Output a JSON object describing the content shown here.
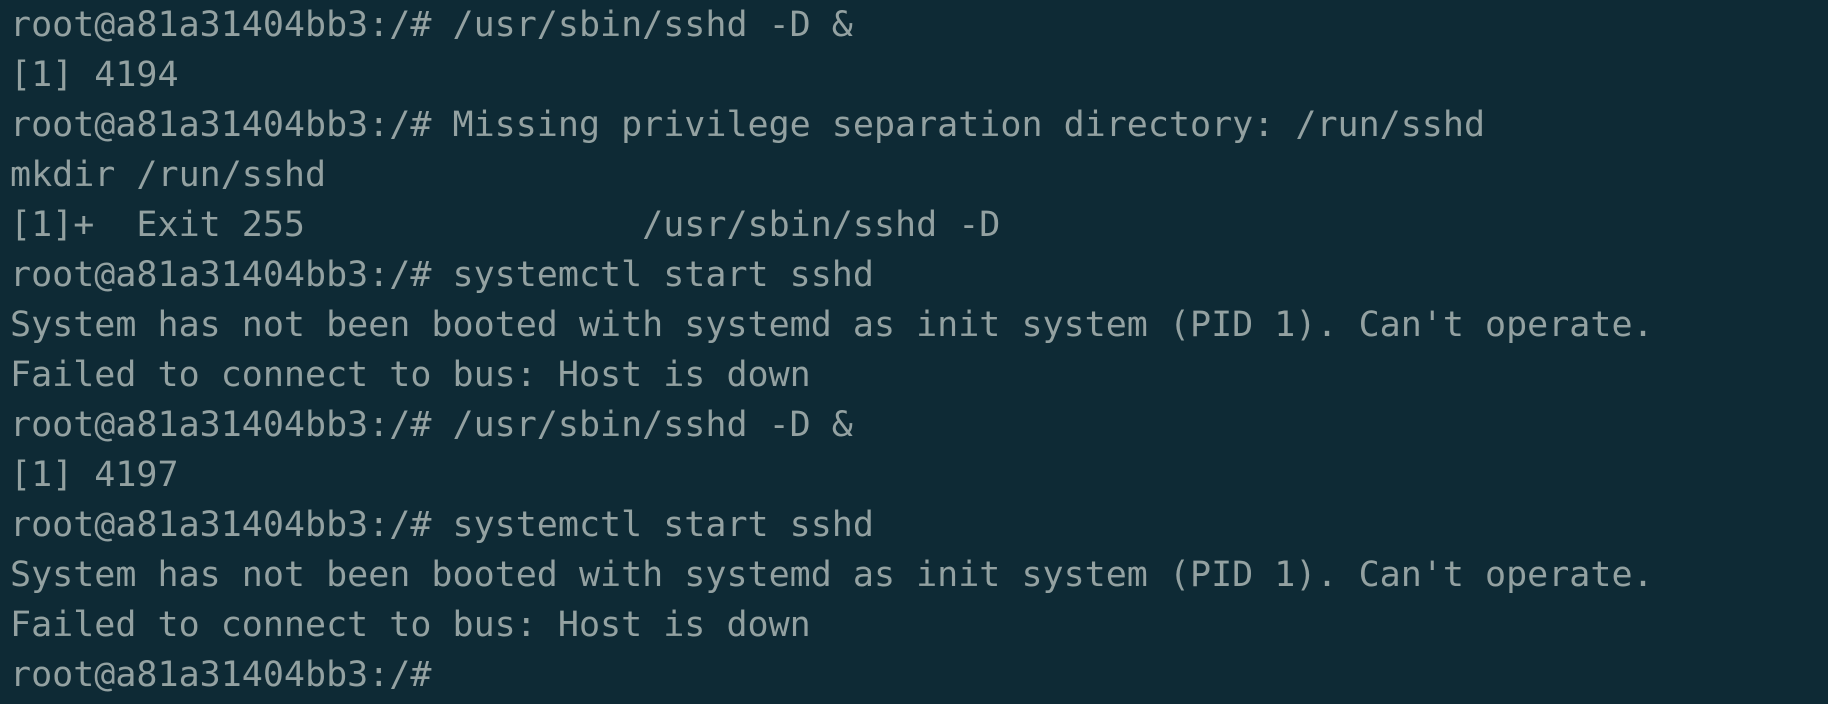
{
  "terminal": {
    "lines": [
      "root@a81a31404bb3:/# /usr/sbin/sshd -D &",
      "[1] 4194",
      "root@a81a31404bb3:/# Missing privilege separation directory: /run/sshd",
      "mkdir /run/sshd",
      "[1]+  Exit 255                /usr/sbin/sshd -D",
      "root@a81a31404bb3:/# systemctl start sshd",
      "System has not been booted with systemd as init system (PID 1). Can't operate.",
      "Failed to connect to bus: Host is down",
      "root@a81a31404bb3:/# /usr/sbin/sshd -D &",
      "[1] 4197",
      "root@a81a31404bb3:/# systemctl start sshd",
      "System has not been booted with systemd as init system (PID 1). Can't operate.",
      "Failed to connect to bus: Host is down",
      "root@a81a31404bb3:/#"
    ]
  },
  "colors": {
    "background": "#0e2a35",
    "text": "#93a1a1"
  }
}
